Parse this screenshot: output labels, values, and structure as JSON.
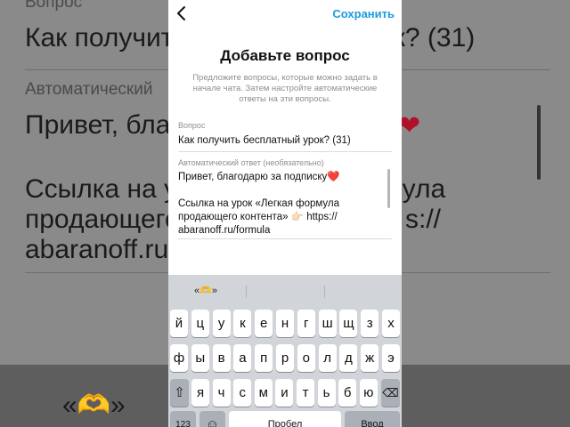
{
  "background": {
    "label_question": "Вопрос",
    "question_text": "Как получить бесплатный урок? (31)",
    "label_auto": "Автоматический",
    "reply_line1": "Привет, благо",
    "reply_line2": "Ссылка на урок «Легкая формула",
    "reply_line3": "продающего",
    "reply_line4": "abaranoff.ru/f",
    "reply_tail": "s://",
    "heart": "❤",
    "suggestion": "«🫶»"
  },
  "header": {
    "save_label": "Сохранить"
  },
  "form": {
    "title": "Добавьте вопрос",
    "description": "Предложите вопросы, которые можно задать в начале чата. Затем настройте автоматические ответы на эти вопросы.",
    "question_label": "Вопрос",
    "question_value": "Как получить бесплатный урок? (31)",
    "answer_label": "Автоматический ответ (необязательно)",
    "answer_line1": "Привет, благодарю за подписку❤️",
    "answer_line2": "Ссылка на урок «Легкая формула",
    "answer_line3": "продающего контента» 👉🏻 https://",
    "answer_line4": "abaranoff.ru/formula"
  },
  "keyboard": {
    "suggestion": "«🫶»",
    "row1": [
      "й",
      "ц",
      "у",
      "к",
      "е",
      "н",
      "г",
      "ш",
      "щ",
      "з",
      "х"
    ],
    "row2": [
      "ф",
      "ы",
      "в",
      "а",
      "п",
      "р",
      "о",
      "л",
      "д",
      "ж",
      "э"
    ],
    "row3": [
      "я",
      "ч",
      "с",
      "м",
      "и",
      "т",
      "ь",
      "б",
      "ю"
    ],
    "shift_icon": "⇧",
    "backspace_icon": "⌫",
    "numbers_label": "123",
    "emoji_icon": "☺",
    "space_label": "Пробел",
    "return_label": "Ввод"
  }
}
